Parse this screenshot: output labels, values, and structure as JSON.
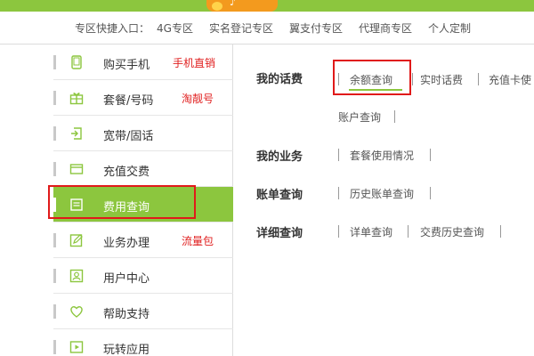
{
  "quick_nav": {
    "label": "专区快捷入口：",
    "items": [
      "4G专区",
      "实名登记专区",
      "翼支付专区",
      "代理商专区",
      "个人定制"
    ]
  },
  "sidebar": {
    "items": [
      {
        "label": "购买手机",
        "tag": "手机直销",
        "icon": "phone-icon"
      },
      {
        "label": "套餐/号码",
        "tag": "淘靓号",
        "icon": "package-icon"
      },
      {
        "label": "宽带/固话",
        "tag": "",
        "icon": "broadband-icon"
      },
      {
        "label": "充值交费",
        "tag": "",
        "icon": "card-icon"
      },
      {
        "label": "费用查询",
        "tag": "",
        "icon": "bill-icon",
        "active": true
      },
      {
        "label": "业务办理",
        "tag": "流量包",
        "icon": "edit-icon"
      },
      {
        "label": "用户中心",
        "tag": "",
        "icon": "user-icon"
      },
      {
        "label": "帮助支持",
        "tag": "",
        "icon": "heart-icon"
      },
      {
        "label": "玩转应用",
        "tag": "",
        "icon": "play-icon"
      }
    ]
  },
  "main": {
    "sections": [
      {
        "title": "我的话费",
        "links": [
          "余额查询",
          "实时话费",
          "充值卡使",
          "账户查询"
        ]
      },
      {
        "title": "我的业务",
        "links": [
          "套餐使用情况"
        ]
      },
      {
        "title": "账单查询",
        "links": [
          "历史账单查询"
        ]
      },
      {
        "title": "详细查询",
        "links": [
          "详单查询",
          "交费历史查询"
        ]
      }
    ]
  },
  "colors": {
    "accent": "#8cc63e",
    "highlight": "#e01a1a",
    "tag": "#e02020"
  }
}
